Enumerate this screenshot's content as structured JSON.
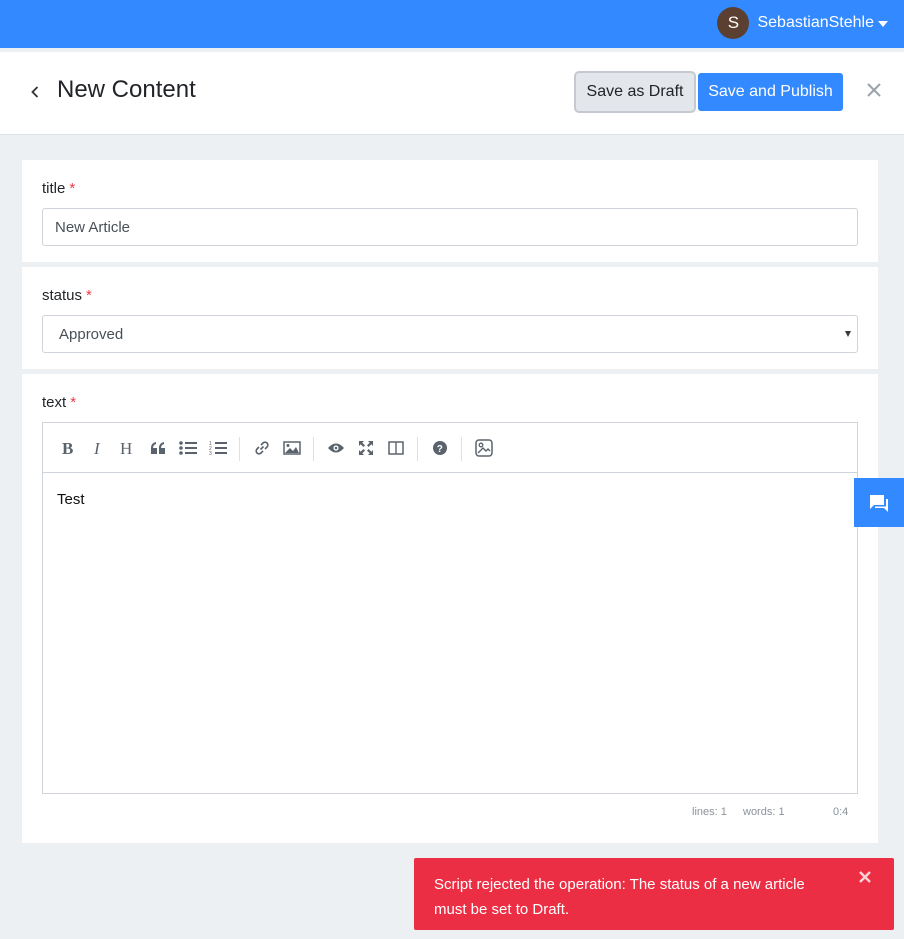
{
  "topbar": {
    "avatar_initial": "S",
    "username": "SebastianStehle"
  },
  "header": {
    "title": "New Content",
    "save_draft_label": "Save as Draft",
    "save_publish_label": "Save and Publish"
  },
  "fields": {
    "title": {
      "label": "title",
      "required_mark": "*",
      "value": "New Article"
    },
    "status": {
      "label": "status",
      "required_mark": "*",
      "selected": "Approved"
    },
    "text": {
      "label": "text",
      "required_mark": "*",
      "content": "Test",
      "toolbar": [
        "bold-icon",
        "italic-icon",
        "heading-icon",
        "quote-icon",
        "unordered-list-icon",
        "ordered-list-icon",
        "link-icon",
        "image-icon",
        "preview-icon",
        "fullscreen-icon",
        "side-by-side-icon",
        "help-icon",
        "asset-image-icon"
      ],
      "status_lines": "lines: 1",
      "status_words": "words: 1",
      "status_cursor": "0:4"
    }
  },
  "toast": {
    "message": "Script rejected the operation: The status of a new article must be set to Draft."
  },
  "colors": {
    "primary": "#3389ff",
    "danger": "#ec2e44",
    "required": "#f03a47",
    "background": "#edf0f3"
  }
}
